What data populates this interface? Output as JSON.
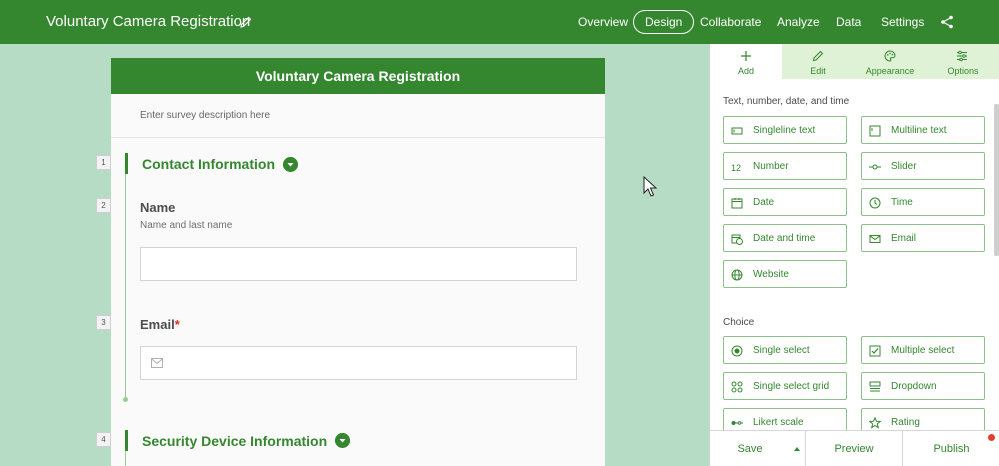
{
  "app": {
    "title": "Voluntary Camera Registration"
  },
  "nav": {
    "items": [
      "Overview",
      "Design",
      "Collaborate",
      "Analyze",
      "Data",
      "Settings"
    ],
    "active": "Design"
  },
  "survey": {
    "header": "Voluntary Camera Registration",
    "description_placeholder": "Enter survey description here",
    "questions": [
      {
        "number": "1",
        "kind": "section",
        "title": "Contact Information"
      },
      {
        "number": "2",
        "label": "Name",
        "hint": "Name and last name",
        "value": ""
      },
      {
        "number": "3",
        "label": "Email",
        "required_mark": "*",
        "value": ""
      },
      {
        "number": "4",
        "kind": "section",
        "title": "Security Device Information"
      }
    ]
  },
  "panel": {
    "tabs": [
      {
        "label": "Add",
        "icon": "plus-icon"
      },
      {
        "label": "Edit",
        "icon": "pencil-icon"
      },
      {
        "label": "Appearance",
        "icon": "palette-icon"
      },
      {
        "label": "Options",
        "icon": "sliders-icon"
      }
    ],
    "active_tab": "Add",
    "groups": [
      {
        "title": "Text, number, date, and time",
        "items": [
          {
            "label": "Singleline text",
            "icon": "singleline-text-icon"
          },
          {
            "label": "Multiline text",
            "icon": "multiline-text-icon"
          },
          {
            "label": "Number",
            "icon": "number-icon"
          },
          {
            "label": "Slider",
            "icon": "slider-icon"
          },
          {
            "label": "Date",
            "icon": "calendar-icon"
          },
          {
            "label": "Time",
            "icon": "clock-icon"
          },
          {
            "label": "Date and time",
            "icon": "calendar-clock-icon"
          },
          {
            "label": "Email",
            "icon": "envelope-icon"
          },
          {
            "label": "Website",
            "icon": "globe-icon"
          }
        ]
      },
      {
        "title": "Choice",
        "items": [
          {
            "label": "Single select",
            "icon": "radio-icon"
          },
          {
            "label": "Multiple select",
            "icon": "checkbox-icon"
          },
          {
            "label": "Single select grid",
            "icon": "grid-icon"
          },
          {
            "label": "Dropdown",
            "icon": "dropdown-icon"
          },
          {
            "label": "Likert scale",
            "icon": "likert-icon"
          },
          {
            "label": "Rating",
            "icon": "star-icon"
          }
        ]
      }
    ],
    "footer": {
      "save": "Save",
      "preview": "Preview",
      "publish": "Publish"
    }
  },
  "colors": {
    "brand": "#35872f",
    "canvas": "#b6dcc6",
    "required": "#d83020",
    "notification": "#e04030"
  }
}
